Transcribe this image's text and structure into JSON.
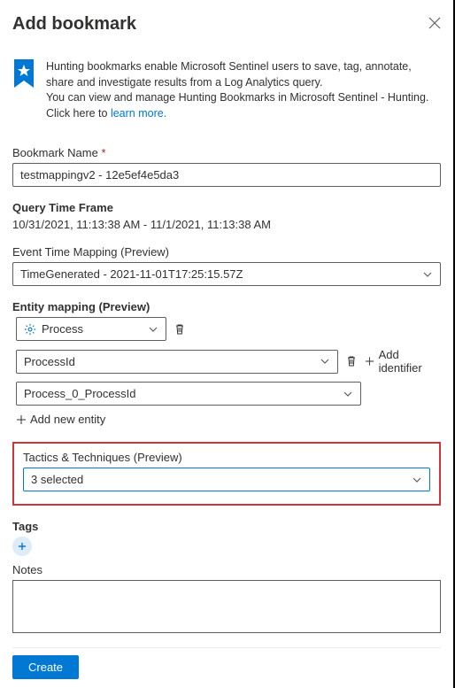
{
  "header": {
    "title": "Add bookmark"
  },
  "info": {
    "line1": "Hunting bookmarks enable Microsoft Sentinel users to save, tag, annotate, share and investigate results from a Log Analytics query.",
    "line2": "You can view and manage Hunting Bookmarks in Microsoft Sentinel - Hunting.",
    "line3_prefix": "Click here to ",
    "link": "learn more."
  },
  "bookmark_name": {
    "label": "Bookmark Name",
    "value": "testmappingv2 - 12e5ef4e5da3"
  },
  "query_time_frame": {
    "label": "Query Time Frame",
    "value": "10/31/2021, 11:13:38 AM - 11/1/2021, 11:13:38 AM"
  },
  "event_time_mapping": {
    "label": "Event Time Mapping (Preview)",
    "value": "TimeGenerated - 2021-11-01T17:25:15.57Z"
  },
  "entity_mapping": {
    "label": "Entity mapping (Preview)",
    "entity_type": "Process",
    "identifier": "ProcessId",
    "value_field": "Process_0_ProcessId",
    "add_identifier_label": "Add identifier",
    "add_entity_label": "Add new entity"
  },
  "tactics": {
    "label": "Tactics & Techniques (Preview)",
    "selected_text": "3 selected"
  },
  "tags": {
    "label": "Tags"
  },
  "notes": {
    "label": "Notes",
    "value": ""
  },
  "footer": {
    "create_label": "Create"
  }
}
